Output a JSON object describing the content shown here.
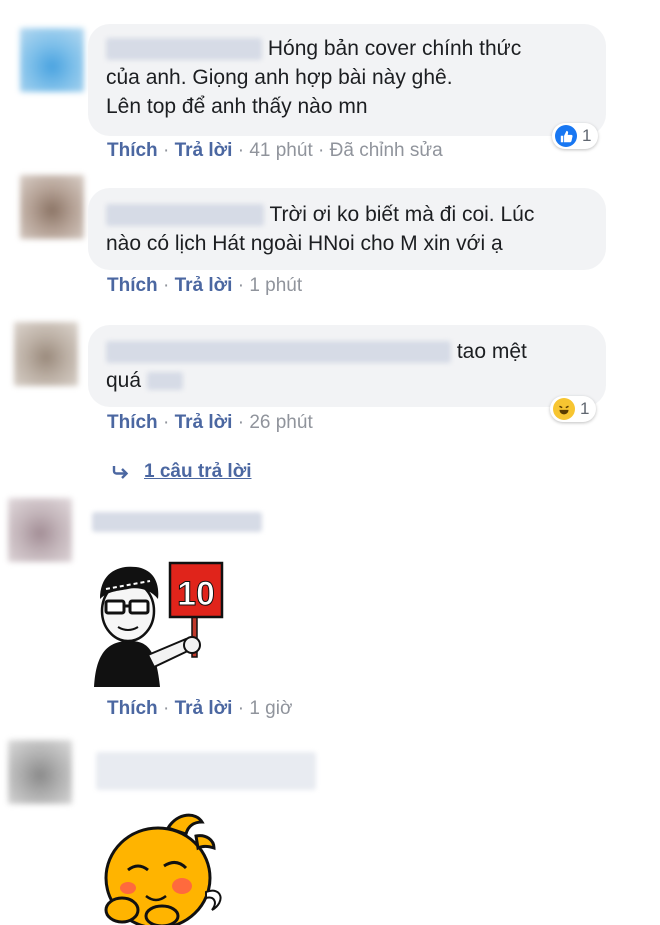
{
  "comments": [
    {
      "text_line1": "Hóng bản cover chính thức",
      "text_line2": "của anh. Giọng anh hợp bài này ghê.",
      "text_line3": "Lên top để anh thấy nào mn",
      "like": "Thích",
      "reply": "Trả lời",
      "time": "41 phút",
      "edited": "Đã chỉnh sửa",
      "reaction_count": "1"
    },
    {
      "text_line1": "Trời ơi ko biết mà đi coi. Lúc",
      "text_line2": "nào có lịch Hát ngoài HNoi cho M xin với ạ",
      "like": "Thích",
      "reply": "Trả lời",
      "time": "1 phút"
    },
    {
      "text_line1": "tao mệt",
      "text_line2": "quá",
      "like": "Thích",
      "reply": "Trả lời",
      "time": "26 phút",
      "reaction_count": "1",
      "replies_link": "1 câu trả lời"
    },
    {
      "sticker_sign": "10",
      "like": "Thích",
      "reply": "Trả lời",
      "time": "1 giờ"
    }
  ],
  "separator": "·",
  "colors": {
    "link": "#4b67a1",
    "meta": "#90949c",
    "bubble": "#f2f3f5",
    "like_blue": "#1877f2"
  },
  "icons": [
    "like-icon",
    "haha-icon",
    "reply-arrow-icon"
  ]
}
